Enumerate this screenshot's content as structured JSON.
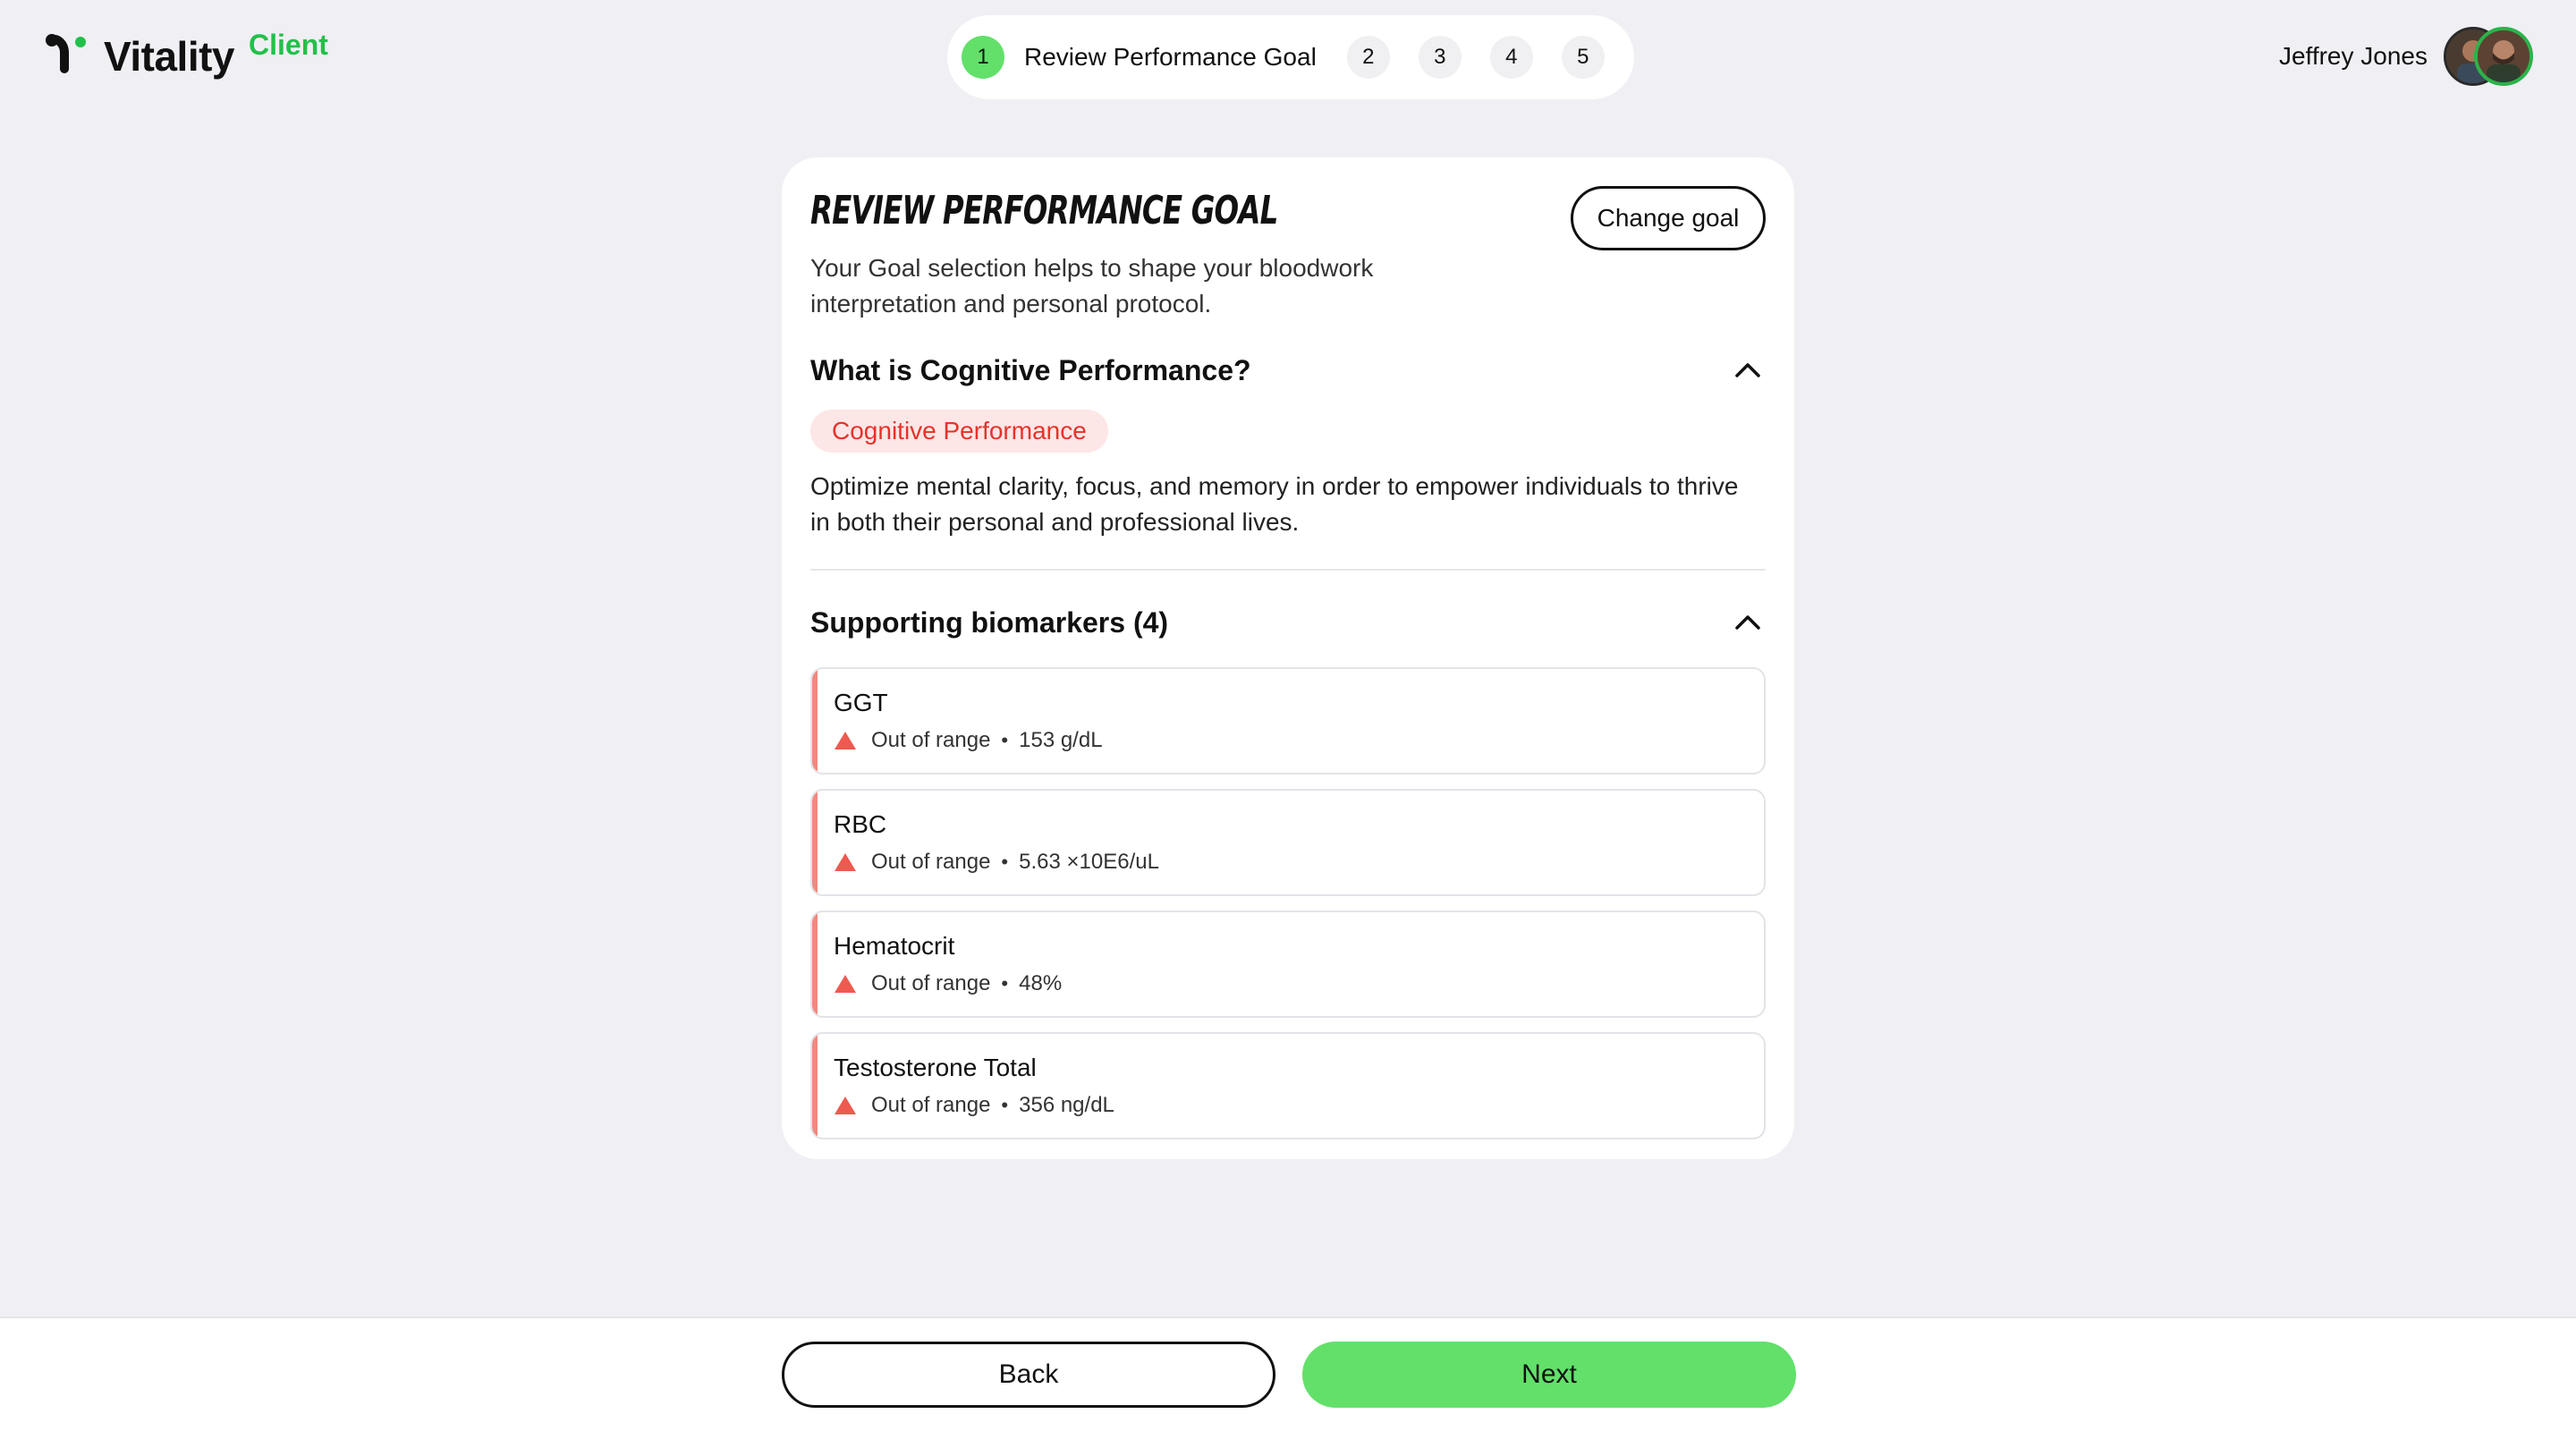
{
  "app": {
    "name": "Vitality",
    "variant": "Client",
    "accent_color": "#62e06a",
    "brand_green": "#22c04a"
  },
  "stepper": {
    "active_step": "1",
    "active_label": "Review Performance Goal",
    "steps": [
      "1",
      "2",
      "3",
      "4",
      "5"
    ]
  },
  "user": {
    "name": "Jeffrey Jones"
  },
  "card": {
    "title": "REVIEW PERFORMANCE GOAL",
    "change_goal_label": "Change goal",
    "subtitle": "Your Goal selection helps to shape your bloodwork interpretation and personal protocol.",
    "what_is": {
      "title": "What is Cognitive Performance?",
      "tag": "Cognitive Performance",
      "description": "Optimize mental clarity, focus, and memory in order to empower individuals to thrive in both their personal and professional lives."
    },
    "biomarkers": {
      "title": "Supporting biomarkers (4)",
      "items": [
        {
          "name": "GGT",
          "status": "Out of range",
          "value": "153 g/dL"
        },
        {
          "name": "RBC",
          "status": "Out of range",
          "value": "5.63 ×10E6/uL"
        },
        {
          "name": "Hematocrit",
          "status": "Out of range",
          "value": "48%"
        },
        {
          "name": "Testosterone Total",
          "status": "Out of range",
          "value": "356 ng/dL"
        }
      ]
    }
  },
  "footer": {
    "back_label": "Back",
    "next_label": "Next"
  },
  "icons": {
    "collapse": "chevron-up-icon",
    "warning": "warning-triangle-icon"
  }
}
